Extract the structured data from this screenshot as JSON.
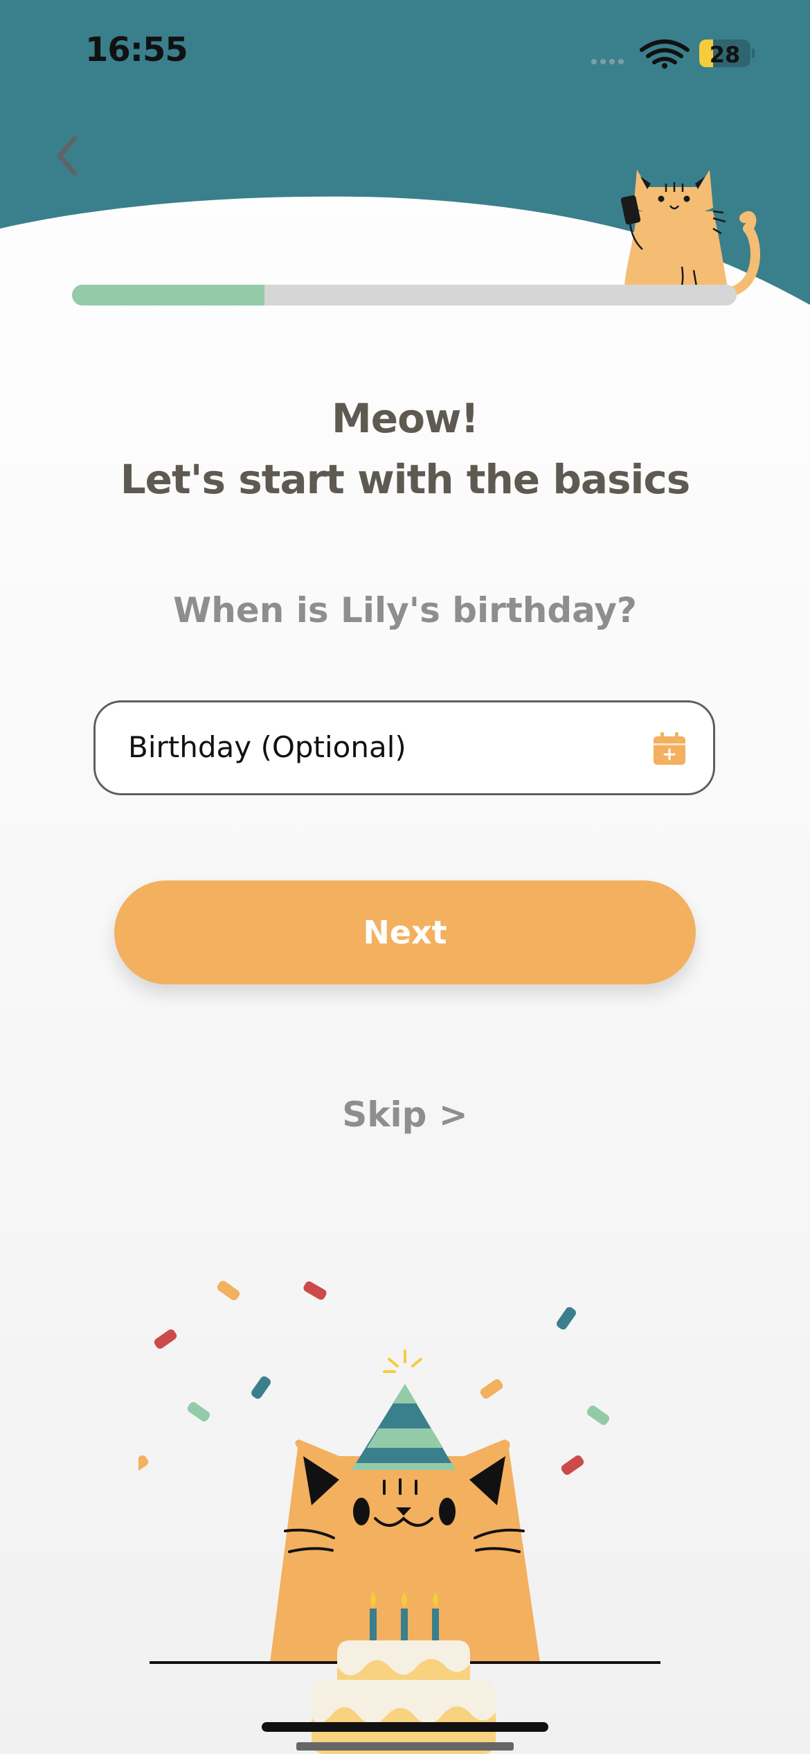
{
  "status_bar": {
    "time": "16:55",
    "battery_level": "28",
    "icons": [
      "signal-dots-icon",
      "wifi-icon",
      "battery-icon"
    ]
  },
  "header": {
    "back_icon": "chevron-left-icon",
    "mascot": "cat-with-phone-illustration"
  },
  "progress": {
    "value": 0.29
  },
  "main": {
    "title_line1": "Meow!",
    "title_line2": "Let's start with the basics",
    "question": "When is Lily's birthday?",
    "birthday_field": {
      "placeholder": "Birthday (Optional)",
      "icon": "calendar-add-icon"
    },
    "next_label": "Next",
    "skip_label": "Skip >"
  },
  "illustration": "cat-with-party-hat-and-birthday-cake",
  "colors": {
    "header_teal": "#3a7f8c",
    "accent_orange": "#f3b05f",
    "progress_green": "#93cba9",
    "title_text": "#5e5a52",
    "muted_text": "#8e8e8e"
  }
}
